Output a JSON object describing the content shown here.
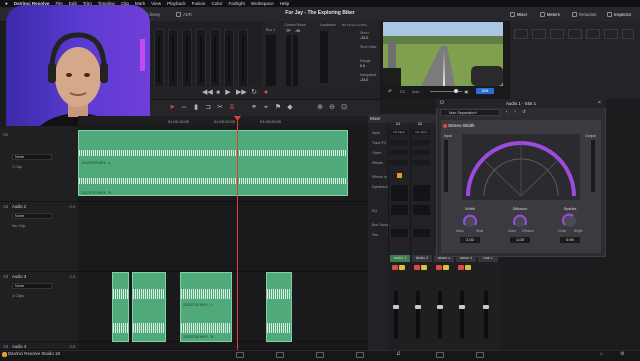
{
  "menubar": {
    "app_name": "DaVinci Resolve",
    "items": [
      "File",
      "Edit",
      "Trim",
      "Timeline",
      "Clip",
      "Mark",
      "View",
      "Playback",
      "Fusion",
      "Color",
      "Fairlight",
      "Workspace",
      "Help"
    ]
  },
  "toolbar": {
    "left": [
      "Media Pool",
      "Effects",
      "Index",
      "Sound Library",
      "ADR"
    ],
    "right": [
      "Mixer",
      "Meters",
      "Metadata",
      "Inspector"
    ]
  },
  "project_title": "For Jay - The Exploring Biker",
  "bus_panel": {
    "bus_label": "Bus 1",
    "control_room_label": "Control Room",
    "loudness_label": "Loudness",
    "loudness_standard": "BS.1770-4 (LUFS)",
    "tp_label": "TP",
    "cr_value": "-96",
    "readings": [
      {
        "label": "Short",
        "value": "-23.0"
      },
      {
        "label": "Short Max",
        "value": ""
      },
      {
        "label": "Range",
        "value": "0.0"
      },
      {
        "label": "Integrated",
        "value": "-23.0"
      }
    ],
    "pause_label": "Pause",
    "reset_label": "Reset"
  },
  "viewer_controls": {
    "auto_label": "Auto",
    "dim_label": "DIM"
  },
  "ruler_ticks": [
    "01:00:15:00",
    "01:00:20:00",
    "01:00:25:00"
  ],
  "tracks": [
    {
      "id": "A1",
      "name": "",
      "volume": "",
      "select": "None",
      "clips": "1 Clip"
    },
    {
      "id": "A2",
      "name": "Audio 2",
      "volume": "2.0",
      "select": "None",
      "clips": "No Clip"
    },
    {
      "id": "A3",
      "name": "Audio 3",
      "volume": "2.0",
      "select": "None",
      "clips": "4 Clips"
    },
    {
      "id": "A4",
      "name": "Audio 4",
      "volume": "2.0",
      "select": "",
      "clips": ""
    }
  ],
  "clips": {
    "a1_top": "20220703 MP4 - L",
    "a1_bottom": "20220703 MP4 - R",
    "a3_label": "20220703 MP4 - L",
    "a3_label_bottom": "20220703 MP4 - R"
  },
  "mixer_lower": {
    "title": "Mixer",
    "columns": [
      "A1",
      "A2"
    ],
    "row_labels": [
      "Input",
      "Track FX",
      "Order",
      "Effects",
      "Effects In",
      "Dynamics",
      "EQ",
      "Bus Sends",
      "Pan"
    ],
    "input_values": [
      "No Input",
      "No Input"
    ]
  },
  "mixer_channels": [
    "Audio 1",
    "Audio 2",
    "Audio 3",
    "Audio 4",
    "Bus 1"
  ],
  "plugin": {
    "title": "Audio 1 - Slot 1",
    "preset": "Max Separation*",
    "module_title": "Stereo Width",
    "input_label": "Input",
    "output_label": "Output",
    "knobs": [
      {
        "label": "Width",
        "value": "2.00",
        "min": "Mono",
        "max": "Wide"
      },
      {
        "label": "Diffusion",
        "value": "1.00",
        "min": "Mono",
        "max": "Diffused"
      },
      {
        "label": "Sparkle",
        "value": "0.90",
        "min": "Clean",
        "max": "Bright"
      }
    ]
  },
  "dock": {
    "label": "DaVinci Resolve Studio 18"
  },
  "colors": {
    "clip_green": "#4fa97a",
    "playhead_red": "#e23b3b",
    "accent_purple": "#9b4be0",
    "fader_blue": "#3a8ae0"
  }
}
